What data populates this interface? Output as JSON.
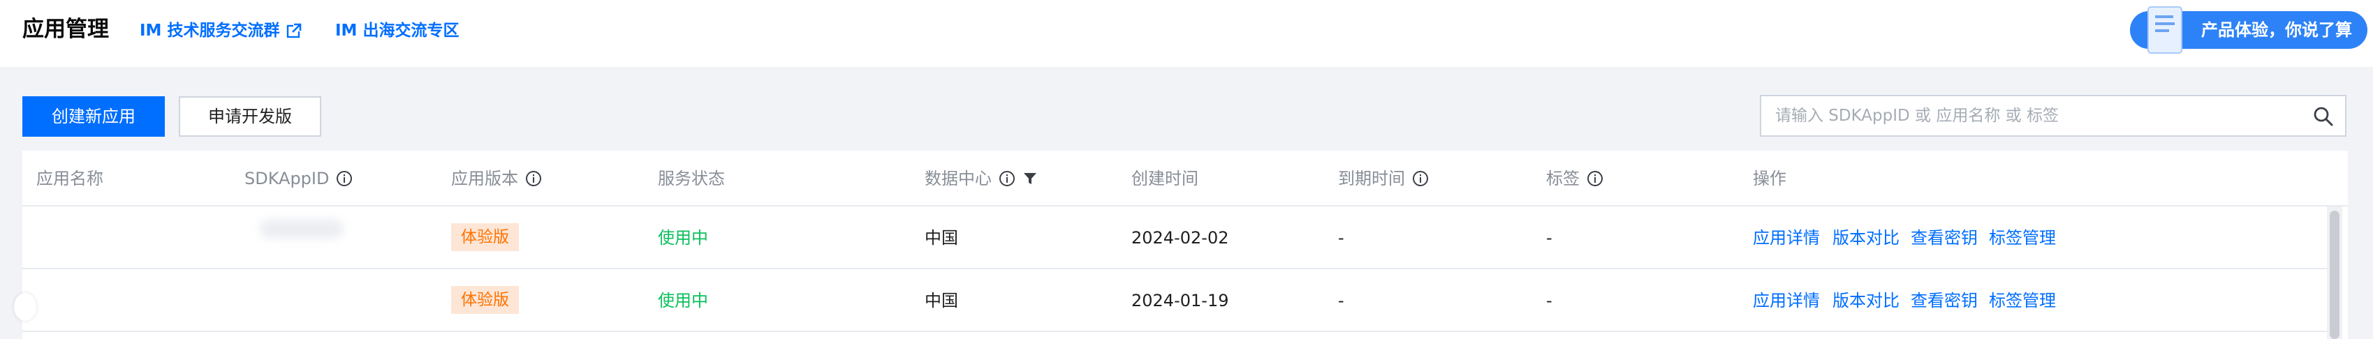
{
  "header": {
    "title": "应用管理",
    "links": [
      {
        "label": "IM 技术服务交流群"
      },
      {
        "label": "IM 出海交流专区"
      }
    ],
    "promo": {
      "label": "产品体验，你说了算"
    }
  },
  "toolbar": {
    "create_label": "创建新应用",
    "apply_label": "申请开发版",
    "search_placeholder": "请输入 SDKAppID 或 应用名称 或 标签"
  },
  "table": {
    "columns": [
      "应用名称",
      "SDKAppID",
      "应用版本",
      "服务状态",
      "数据中心",
      "创建时间",
      "到期时间",
      "标签",
      "操作"
    ],
    "rows": [
      {
        "name": "",
        "version": "体验版",
        "status": "使用中",
        "datacenter": "中国",
        "created": "2024-02-02",
        "expires": "-",
        "tags": "-"
      },
      {
        "name": "",
        "version": "体验版",
        "status": "使用中",
        "datacenter": "中国",
        "created": "2024-01-19",
        "expires": "-",
        "tags": "-"
      }
    ],
    "actions": [
      "应用详情",
      "版本对比",
      "查看密钥",
      "标签管理"
    ]
  },
  "colors": {
    "primary": "#006eff",
    "success": "#0abf5b",
    "trial_badge_bg": "#fde6d6",
    "trial_badge_text": "#ff7200"
  },
  "icons": [
    "external-link-icon",
    "info-icon",
    "filter-icon",
    "search-icon",
    "promo-document-icon"
  ]
}
